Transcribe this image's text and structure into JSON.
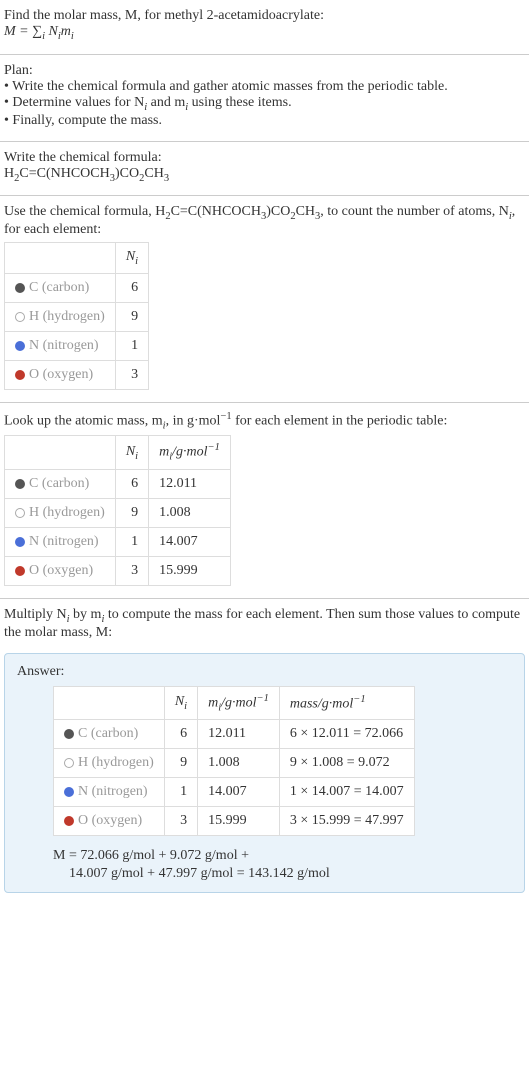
{
  "intro": {
    "line1": "Find the molar mass, M, for methyl 2-acetamidoacrylate:",
    "formula_label": "M = ∑",
    "formula_sub": "i",
    "formula_rest": " N",
    "formula_rest2": "m"
  },
  "plan": {
    "heading": "Plan:",
    "item1": "• Write the chemical formula and gather atomic masses from the periodic table.",
    "item2_a": "• Determine values for N",
    "item2_b": " and m",
    "item2_c": " using these items.",
    "item3": "• Finally, compute the mass."
  },
  "write_formula": {
    "heading": "Write the chemical formula:",
    "formula_a": "H",
    "formula_b": "C=C(NHCOCH",
    "formula_c": ")CO",
    "formula_d": "CH",
    "s2a": "2",
    "s3a": "3",
    "s2b": "2",
    "s3b": "3"
  },
  "count_text": {
    "a": "Use the chemical formula, H",
    "b": "C=C(NHCOCH",
    "c": ")CO",
    "d": "CH",
    "e": ", to count the number of atoms, N",
    "f": ", for each element:",
    "s2a": "2",
    "s3a": "3",
    "s2b": "2",
    "s3b": "3",
    "si": "i"
  },
  "table1": {
    "header_ni": "N",
    "header_ni_sub": "i",
    "rows": [
      {
        "dot": "carbon",
        "label": "C (carbon)",
        "ni": "6"
      },
      {
        "dot": "hydrogen",
        "label": "H (hydrogen)",
        "ni": "9"
      },
      {
        "dot": "nitrogen",
        "label": "N (nitrogen)",
        "ni": "1"
      },
      {
        "dot": "oxygen",
        "label": "O (oxygen)",
        "ni": "3"
      }
    ]
  },
  "lookup_text": {
    "a": "Look up the atomic mass, m",
    "b": ", in g·mol",
    "c": " for each element in the periodic table:",
    "si": "i",
    "sup": "−1"
  },
  "table2": {
    "header_ni": "N",
    "header_ni_sub": "i",
    "header_mi": "m",
    "header_mi_sub": "i",
    "header_mi_unit": "/g·mol",
    "header_mi_sup": "−1",
    "rows": [
      {
        "dot": "carbon",
        "label": "C (carbon)",
        "ni": "6",
        "mi": "12.011"
      },
      {
        "dot": "hydrogen",
        "label": "H (hydrogen)",
        "ni": "9",
        "mi": "1.008"
      },
      {
        "dot": "nitrogen",
        "label": "N (nitrogen)",
        "ni": "1",
        "mi": "14.007"
      },
      {
        "dot": "oxygen",
        "label": "O (oxygen)",
        "ni": "3",
        "mi": "15.999"
      }
    ]
  },
  "multiply_text": {
    "a": "Multiply N",
    "b": " by m",
    "c": " to compute the mass for each element. Then sum those values to compute the molar mass, M:",
    "si": "i"
  },
  "answer": {
    "label": "Answer:",
    "header_ni": "N",
    "header_ni_sub": "i",
    "header_mi": "m",
    "header_mi_sub": "i",
    "header_mi_unit": "/g·mol",
    "header_mi_sup": "−1",
    "header_mass": "mass/g·mol",
    "header_mass_sup": "−1",
    "rows": [
      {
        "dot": "carbon",
        "label": "C (carbon)",
        "ni": "6",
        "mi": "12.011",
        "mass": "6 × 12.011 = 72.066"
      },
      {
        "dot": "hydrogen",
        "label": "H (hydrogen)",
        "ni": "9",
        "mi": "1.008",
        "mass": "9 × 1.008 = 9.072"
      },
      {
        "dot": "nitrogen",
        "label": "N (nitrogen)",
        "ni": "1",
        "mi": "14.007",
        "mass": "1 × 14.007 = 14.007"
      },
      {
        "dot": "oxygen",
        "label": "O (oxygen)",
        "ni": "3",
        "mi": "15.999",
        "mass": "3 × 15.999 = 47.997"
      }
    ],
    "result1": "M = 72.066 g/mol + 9.072 g/mol +",
    "result2": "14.007 g/mol + 47.997 g/mol = 143.142 g/mol"
  }
}
